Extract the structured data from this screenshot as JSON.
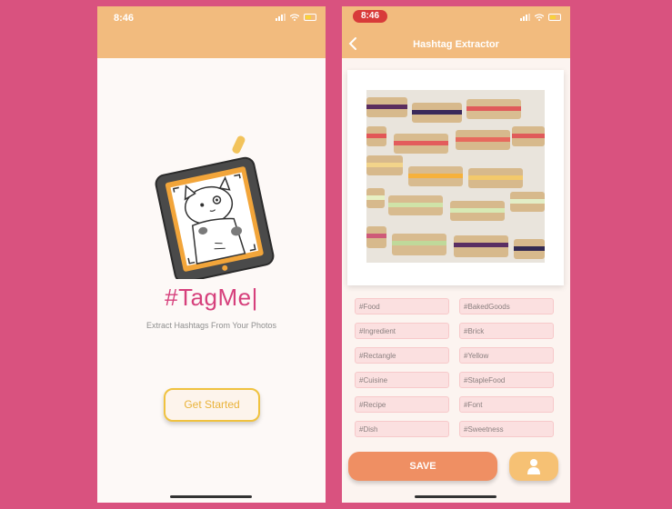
{
  "left_screen": {
    "status": {
      "time": "8:46"
    },
    "title": "#TagMe|",
    "subtitle": "Extract Hashtags From Your Photos",
    "get_started_label": "Get Started"
  },
  "right_screen": {
    "status": {
      "time": "8:46"
    },
    "nav": {
      "title": "Hashtag Extractor"
    },
    "tags": [
      "#Food",
      "#BakedGoods",
      "#Ingredient",
      "#Brick",
      "#Rectangle",
      "#Yellow",
      "#Cuisine",
      "#StapleFood",
      "#Recipe",
      "#Font",
      "#Dish",
      "#Sweetness"
    ],
    "save_label": "SAVE",
    "profile_icon": "person-icon"
  },
  "colors": {
    "background": "#d9527f",
    "header": "#f2bb7e",
    "title_pink": "#d6407c",
    "button_yellow": "#f0c23f",
    "save_orange": "#ef8f63",
    "tag_bg": "#fbe0e0"
  }
}
